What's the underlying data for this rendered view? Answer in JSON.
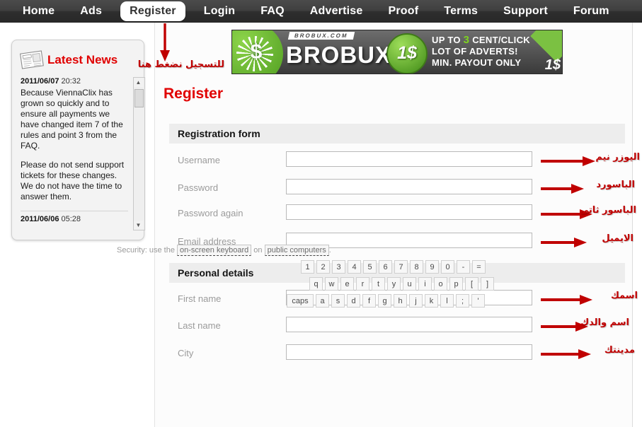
{
  "nav": {
    "items": [
      {
        "label": "Home",
        "active": false
      },
      {
        "label": "Ads",
        "active": false
      },
      {
        "label": "Register",
        "active": true
      },
      {
        "label": "Login",
        "active": false
      },
      {
        "label": "FAQ",
        "active": false
      },
      {
        "label": "Advertise",
        "active": false
      },
      {
        "label": "Proof",
        "active": false
      },
      {
        "label": "Terms",
        "active": false
      },
      {
        "label": "Support",
        "active": false
      },
      {
        "label": "Forum",
        "active": false
      }
    ]
  },
  "annotation": {
    "top_caption": "للتسجيل نضغط هنا",
    "arrow_color": "#c00000"
  },
  "news": {
    "title": "Latest News",
    "icon": "newspaper-icon",
    "entries": [
      {
        "date": "2011/06/07",
        "time": "20:32",
        "paragraphs": [
          "Because ViennaClix has grown so quickly and to ensure all payments we have changed item 7 of the rules and point 3 from the FAQ.",
          "Please do not send support tickets for these changes. We do not have the time to answer them."
        ]
      },
      {
        "date": "2011/06/06",
        "time": "05:28",
        "paragraphs": []
      }
    ]
  },
  "banner": {
    "site": "BROBUX.COM",
    "brand": "BROBUX",
    "coin": "1$",
    "line1_pre": "UP TO ",
    "line1_hi": "3",
    "line1_post": " CENT/CLICK",
    "line2": "LOT OF ADVERTS!",
    "line3": "MIN. PAYOUT ONLY",
    "small_coin": "1$"
  },
  "page": {
    "title": "Register",
    "title_color": "#e10000"
  },
  "form": {
    "sections": [
      {
        "heading": "Registration form",
        "fields": [
          {
            "label": "Username",
            "value": "",
            "placeholder": "",
            "callout": "اليوزر نيم"
          },
          {
            "label": "Password",
            "value": "",
            "placeholder": "",
            "callout": "الباسورد"
          },
          {
            "label": "Password again",
            "value": "",
            "placeholder": "",
            "callout": "الباسور ثاتى"
          },
          {
            "label": "Email address",
            "value": "",
            "placeholder": "",
            "callout": "الايميل"
          }
        ]
      },
      {
        "heading": "Personal details",
        "fields": [
          {
            "label": "First name",
            "value": "",
            "placeholder": "",
            "callout": "اسمك"
          },
          {
            "label": "Last name",
            "value": "",
            "placeholder": "",
            "callout": "اسم والدك"
          },
          {
            "label": "City",
            "value": "",
            "placeholder": "",
            "callout": "مدينتك"
          }
        ]
      }
    ]
  },
  "security": {
    "prefix": "Security: use the ",
    "link1": "on-screen keyboard",
    "middle": " on ",
    "link2": "public computers",
    "suffix": ".",
    "keyboard": {
      "row1": [
        "1",
        "2",
        "3",
        "4",
        "5",
        "6",
        "7",
        "8",
        "9",
        "0",
        "-",
        "="
      ],
      "row2": [
        "q",
        "w",
        "e",
        "r",
        "t",
        "y",
        "u",
        "i",
        "o",
        "p",
        "[",
        "]"
      ],
      "row3": [
        "caps",
        "a",
        "s",
        "d",
        "f",
        "g",
        "h",
        "j",
        "k",
        "l",
        ";",
        "'"
      ]
    }
  }
}
